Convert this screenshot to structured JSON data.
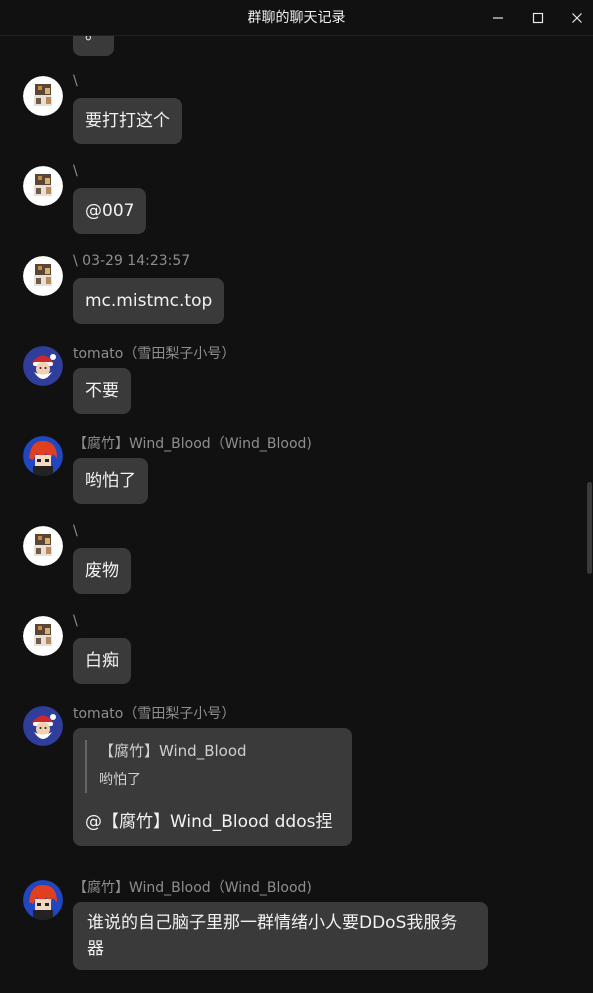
{
  "window": {
    "title": "群聊的聊天记录",
    "controls": [
      "minimize-icon",
      "maximize-icon",
      "close-icon"
    ]
  },
  "messages": [
    {
      "id": "m0",
      "sender": "",
      "text": "。",
      "avatar": "cat-avatar"
    },
    {
      "id": "m1",
      "sender": "\\",
      "text": "要打打这个",
      "avatar": "cat-avatar"
    },
    {
      "id": "m2",
      "sender": "\\",
      "text": "@007",
      "avatar": "cat-avatar"
    },
    {
      "id": "m3",
      "sender": "\\ 03-29 14:23:57",
      "text": "mc.mistmc.top",
      "avatar": "cat-avatar"
    },
    {
      "id": "m4",
      "sender": "tomato（雪田梨子小号）",
      "text": "不要",
      "avatar": "santa-avatar"
    },
    {
      "id": "m5",
      "sender": "【腐竹】Wind_Blood（Wind_Blood)",
      "text": "哟怕了",
      "avatar": "redhair-avatar"
    },
    {
      "id": "m6",
      "sender": "\\",
      "text": "废物",
      "avatar": "cat-avatar"
    },
    {
      "id": "m7",
      "sender": "\\",
      "text": "白痴",
      "avatar": "cat-avatar"
    },
    {
      "id": "m8",
      "sender": "tomato（雪田梨子小号）",
      "avatar": "santa-avatar",
      "quote": {
        "name": "【腐竹】Wind_Blood",
        "text": "哟怕了"
      },
      "text": "@【腐竹】Wind_Blood ddos捏"
    },
    {
      "id": "m9",
      "sender": "【腐竹】Wind_Blood（Wind_Blood)",
      "avatar": "redhair-avatar",
      "text": "谁说的自己脑子里那一群情绪小人要DDoS我服务器"
    }
  ]
}
